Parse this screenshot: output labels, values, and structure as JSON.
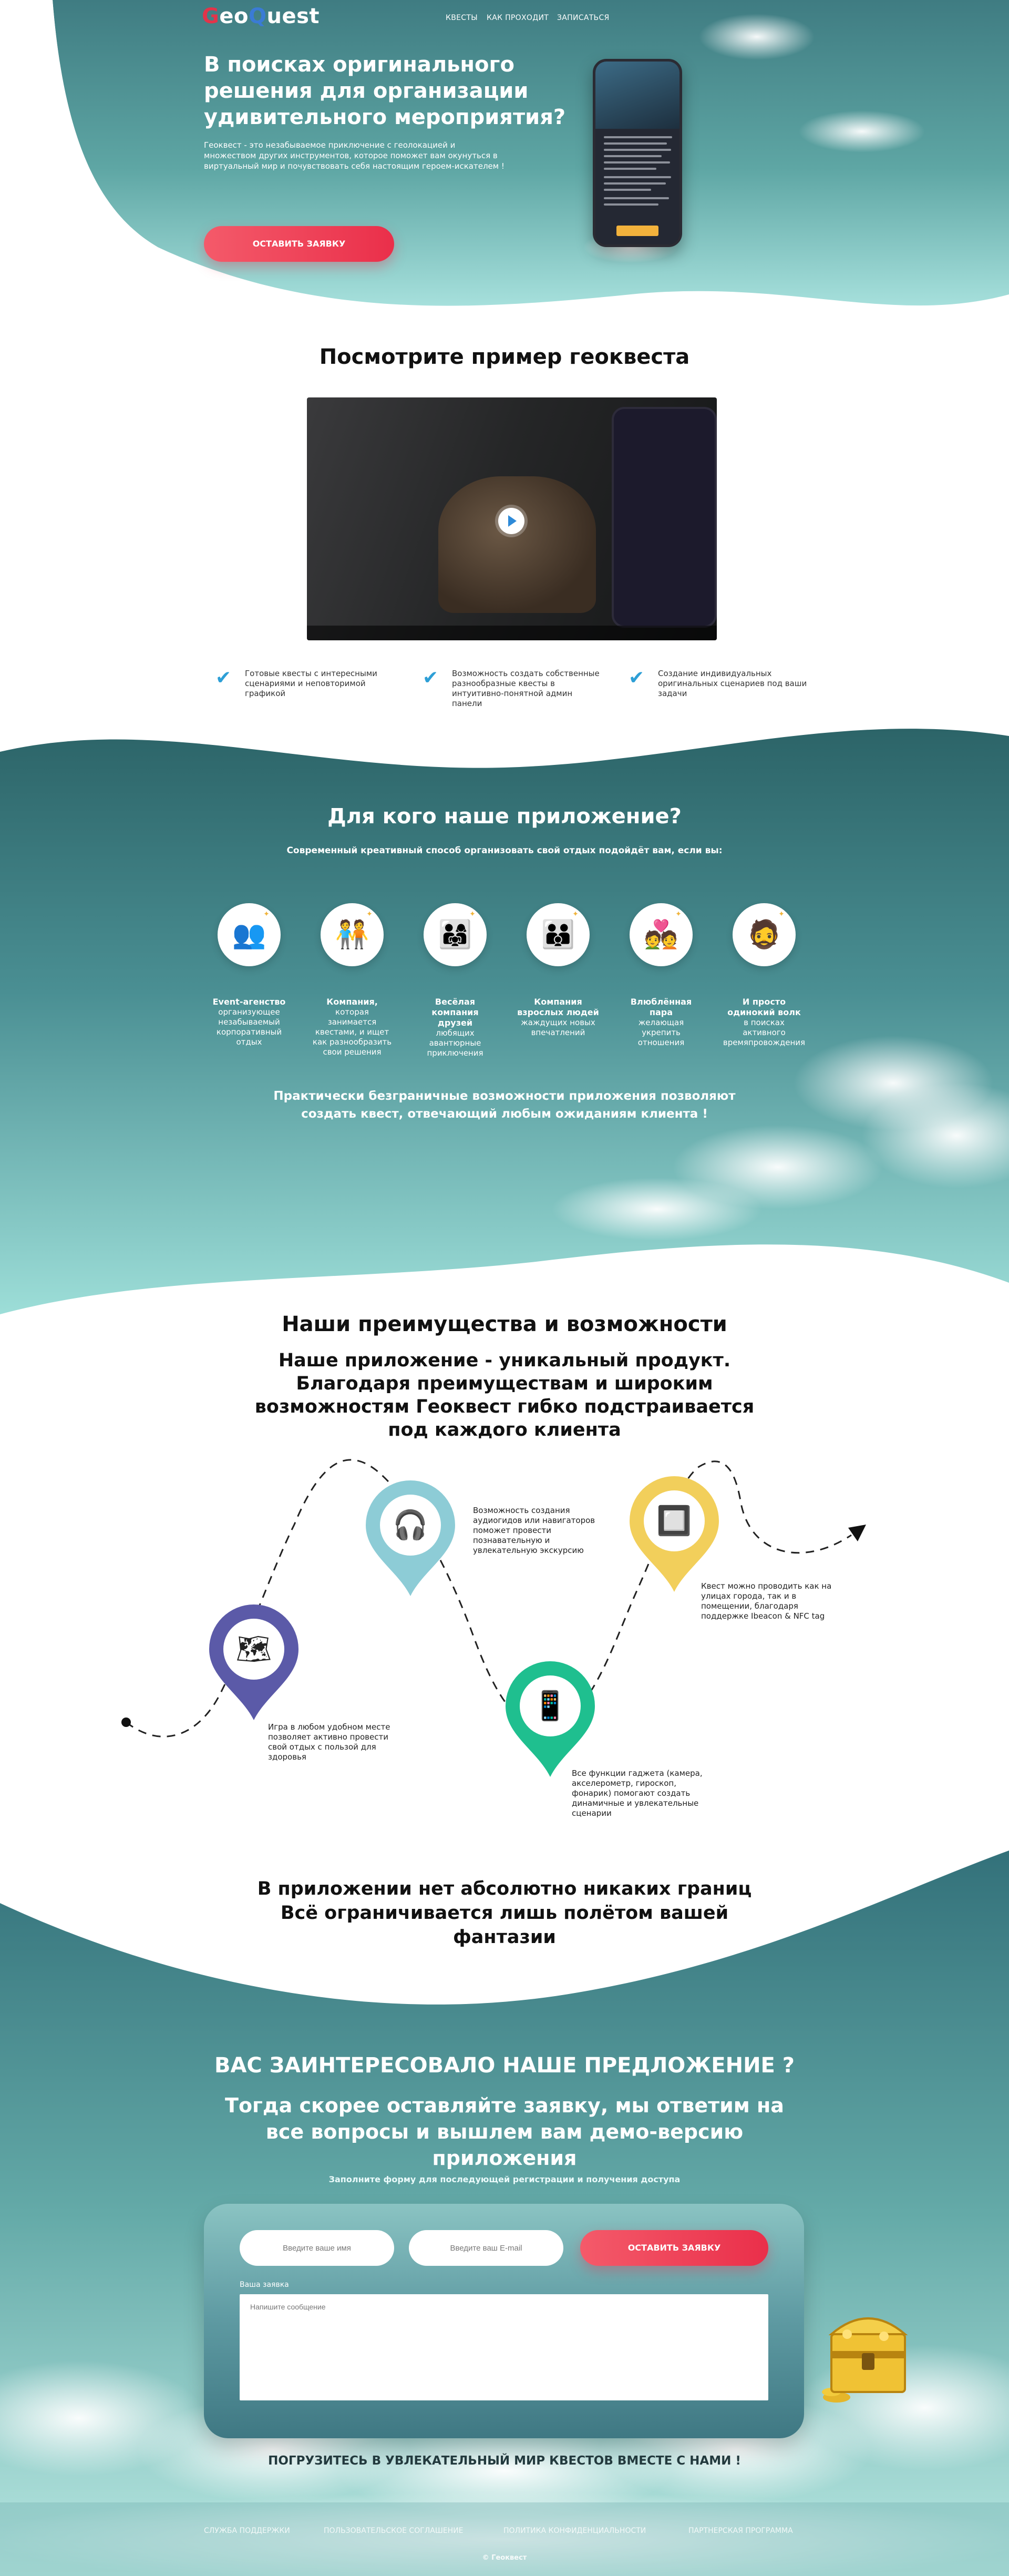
{
  "logo": {
    "prefix": "",
    "pin1": "G",
    "middle": "eo",
    "pin2": "Q",
    "suffix": "uest"
  },
  "nav": [
    "КВЕСТЫ",
    "КАК ПРОХОДИТ",
    "ЗАПИСАТЬСЯ"
  ],
  "hero": {
    "title": "В поисках оригинального решения для организации удивительного мероприятия?",
    "description": "Геоквест - это незабываемое приключение с геолокацией и множеством других инструментов, которое поможет вам окунуться в виртуальный мир и почувствовать себя настоящим героем-искателем !",
    "button": "ОСТАВИТЬ ЗАЯВКУ"
  },
  "example": {
    "title": "Посмотрите пример геоквеста",
    "features": [
      "Готовые квесты с интересными сценариями и неповторимой графикой",
      "Возможность создать собственные разнообразные квесты в интуитивно-понятной админ панели",
      "Создание индивидуальных оригинальных сценариев под ваши задачи"
    ]
  },
  "audience": {
    "title": "Для кого наше приложение?",
    "subtitle": "Современный креативный способ организовать свой отдых подойдёт вам, если вы:",
    "items": [
      {
        "title": "Event-агенство",
        "desc": "организующее незабываемый корпоративный отдых",
        "icon": "👥"
      },
      {
        "title": "Компания,",
        "desc": "которая занимается квестами, и ищет как разнообразить свои решения",
        "icon": "🧑‍🤝‍🧑"
      },
      {
        "title": "Весёлая компания друзей",
        "desc": "любящих авантюрные приключения",
        "icon": "👨‍👩‍👧"
      },
      {
        "title": "Компания взрослых людей",
        "desc": "жаждущих новых впечатлений",
        "icon": "👪"
      },
      {
        "title": "Влюблённая пара",
        "desc": "желающая укрепить отношения",
        "icon": "💑"
      },
      {
        "title": "И просто одинокий волк",
        "desc": "в поисках активного времяпровождения",
        "icon": "🧔"
      }
    ],
    "footer": "Практически безграничные возможности приложения позволяют создать квест, отвечающий любым ожиданиям клиента !"
  },
  "advantages": {
    "title": "Наши преимущества и возможности",
    "subtitle": "Наше приложение - уникальный продукт. Благодаря преимуществам и широким возможностям Геоквест гибко подстраивается под каждого клиента",
    "items": [
      {
        "text": "Игра в любом удобном месте позволяет активно провести свой отдых с пользой для здоровья",
        "color": "#5b5aa8",
        "icon": "🗺"
      },
      {
        "text": "Возможность создания аудиогидов или навигаторов поможет провести познавательную и увлекательную экскурсию",
        "color": "#8dccd6",
        "icon": "🎧"
      },
      {
        "text": "Все функции гаджета (камера, акселерометр, гироскоп, фонарик) помогают создать динамичные и увлекательные сценарии",
        "color": "#1fbf8f",
        "icon": "📱"
      },
      {
        "text": "Квест можно проводить как на улицах города, так и в помещении, благодаря поддержке Ibeacon & NFC tag",
        "color": "#f2cf5b",
        "icon": "🔲"
      }
    ],
    "limits": "В приложении нет абсолютно никаких границ Всё ограничивается лишь полётом вашей фантазии"
  },
  "cta": {
    "title": "ВАС ЗАИНТЕРЕСОВАЛО НАШЕ ПРЕДЛОЖЕНИЕ ?",
    "subtitle": "Тогда скорее оставляйте заявку, мы ответим на все вопросы и вышлем вам демо-версию приложения",
    "note": "Заполните форму для последующей регистрации и получения доступа",
    "name_placeholder": "Введите ваше имя",
    "email_placeholder": "Введите ваш E-mail",
    "button": "ОСТАВИТЬ ЗАЯВКУ",
    "message_label": "Ваша заявка",
    "message_placeholder": "Напишите сообщение",
    "immerse": "ПОГРУЗИТЕСЬ В УВЛЕКАТЕЛЬНЫЙ МИР КВЕСТОВ ВМЕСТЕ С НАМИ !"
  },
  "footer": {
    "links": [
      "СЛУЖБА ПОДДЕРЖКИ",
      "ПОЛЬЗОВАТЕЛЬСКОЕ СОГЛАШЕНИЕ",
      "ПОЛИТИКА КОНФИДЕНЦИАЛЬНОСТИ",
      "ПАРТНЕРСКАЯ ПРОГРАММА"
    ],
    "copyright": "© Геоквест"
  },
  "colors": {
    "teal_dark": "#3b7a82",
    "teal_light": "#8fd8d4",
    "accent_red": "#ea2f4a",
    "check_blue": "#2d9fd6"
  }
}
